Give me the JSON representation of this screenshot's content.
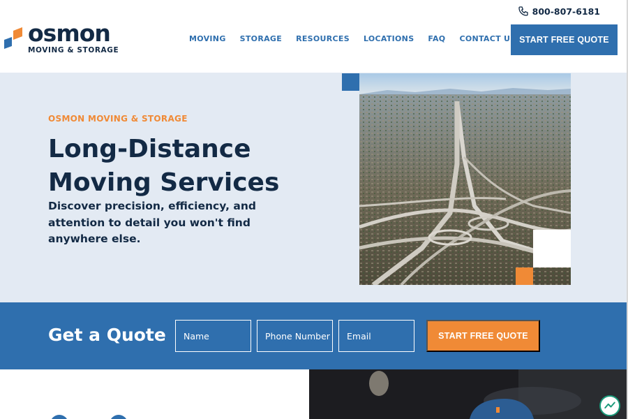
{
  "brand": {
    "name": "osmon",
    "tagline": "MOVING & STORAGE",
    "colors": {
      "navy": "#132a45",
      "blue": "#2f6fae",
      "orange": "#f08a36",
      "hero_bg": "#e3eaf3"
    }
  },
  "header": {
    "phone": "800-807-6181",
    "phone_icon": "phone-icon",
    "nav": [
      {
        "label": "MOVING"
      },
      {
        "label": "STORAGE"
      },
      {
        "label": "RESOURCES"
      },
      {
        "label": "LOCATIONS"
      },
      {
        "label": "FAQ"
      },
      {
        "label": "CONTACT US"
      }
    ],
    "cta_label": "START FREE QUOTE"
  },
  "hero": {
    "eyebrow": "OSMON MOVING & STORAGE",
    "title_line1": "Long-Distance",
    "title_line2": "Moving Services",
    "subtitle": "Discover precision, efficiency, and attention to detail you won't find anywhere else.",
    "image_subject": "aerial-highway-interchange-city"
  },
  "quote": {
    "title": "Get a Quote",
    "name_placeholder": "Name",
    "phone_placeholder": "Phone Number",
    "email_placeholder": "Email",
    "button_label": "START FREE QUOTE"
  },
  "widgets": {
    "chat_icon": "chat-widget-icon"
  }
}
